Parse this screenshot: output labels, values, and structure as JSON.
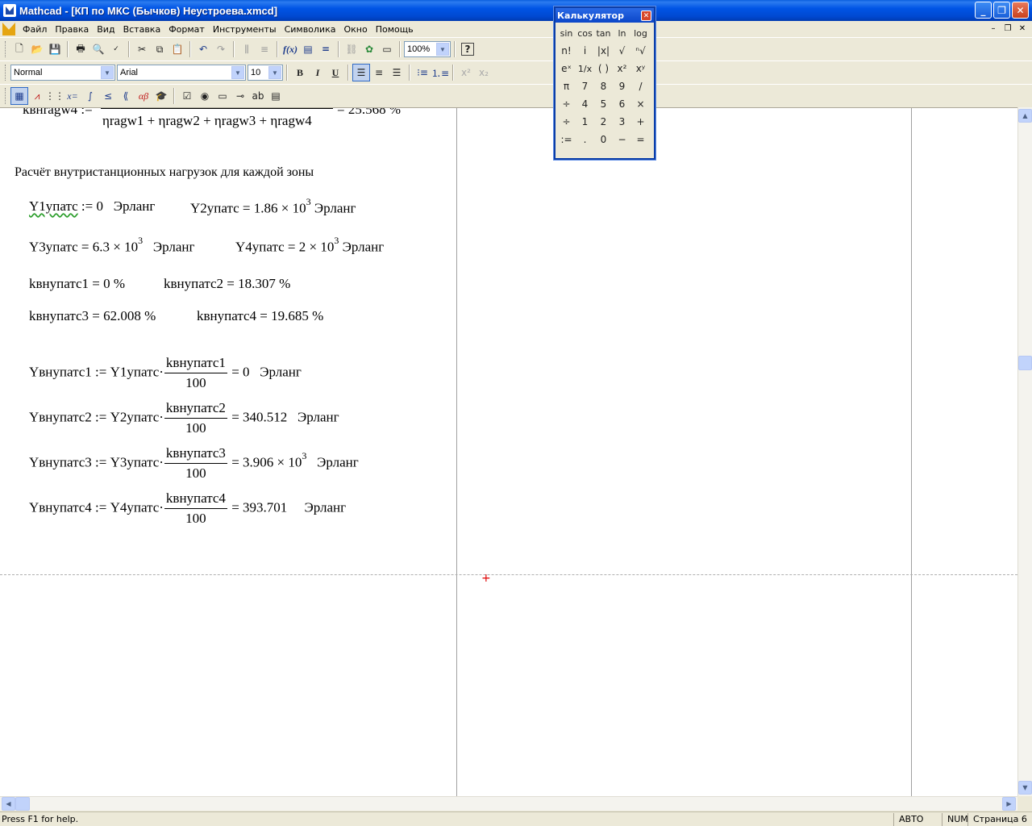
{
  "window": {
    "title": "Mathcad - [КП по МКС (Бычков) Неустроева.xmcd]",
    "buttons": [
      "_",
      "❐",
      "✕"
    ]
  },
  "menu": {
    "items": [
      "Файл",
      "Правка",
      "Вид",
      "Вставка",
      "Формат",
      "Инструменты",
      "Символика",
      "Окно",
      "Помощь"
    ],
    "mdi_buttons": [
      "–",
      "❐",
      "✕"
    ]
  },
  "toolbar_standard": {
    "zoom": "100%"
  },
  "toolbar_formatting": {
    "style": "Normal",
    "font": "Arial",
    "size": "10",
    "bold": "B",
    "italic": "I",
    "underline": "U"
  },
  "document": {
    "top_partial": {
      "lhs": "kвнragw4 :=",
      "rhs": "= 25.568 %",
      "den": "ηragw1 + ηragw2 + ηragw3 + ηragw4"
    },
    "heading": "Расчёт внутристанционных нагрузок для каждой зоны",
    "y1": {
      "name": "Y1упатс",
      "op": ":= 0",
      "unit": "Эрланг"
    },
    "y2": {
      "name": "Y2упатс = 1.86 × 10",
      "exp": "3",
      "unit": "Эрланг"
    },
    "y3": {
      "name": "Y3упатс = 6.3 × 10",
      "exp": "3",
      "unit": "Эрланг"
    },
    "y4": {
      "name": "Y4упатс = 2 × 10",
      "exp": "3",
      "unit": "Эрланг"
    },
    "k1": "kвнупатс1 = 0  %",
    "k2": "kвнупатс2 = 18.307  %",
    "k3": "kвнупатс3 = 62.008  %",
    "k4": "kвнупатс4 = 19.685  %",
    "formulas": [
      {
        "lhs": "Yвнупатс1 := Y1упатс·",
        "num": "kвнупатс1",
        "den": "100",
        "rhs": "= 0",
        "exp": "",
        "unit": "Эрланг"
      },
      {
        "lhs": "Yвнупатс2 := Y2упатс·",
        "num": "kвнупатс2",
        "den": "100",
        "rhs": "= 340.512",
        "exp": "",
        "unit": "Эрланг"
      },
      {
        "lhs": "Yвнупатс3 := Y3упатс·",
        "num": "kвнупатс3",
        "den": "100",
        "rhs": "= 3.906 × 10",
        "exp": "3",
        "unit": "Эрланг"
      },
      {
        "lhs": "Yвнупатс4 := Y4упатс·",
        "num": "kвнупатс4",
        "den": "100",
        "rhs": "= 393.701",
        "exp": "",
        "unit": "Эрланг"
      }
    ]
  },
  "calculator": {
    "title": "Калькулятор",
    "keys": [
      "sin",
      "cos",
      "tan",
      "ln",
      "log",
      "n!",
      "i",
      "|x|",
      "√",
      "ⁿ√",
      "eˣ",
      "1/x",
      "( )",
      "x²",
      "xʸ",
      "π",
      "7",
      "8",
      "9",
      "/",
      "÷",
      "4",
      "5",
      "6",
      "×",
      "÷",
      "1",
      "2",
      "3",
      "+",
      ":=",
      ".",
      "0",
      "−",
      "="
    ]
  },
  "status": {
    "help": "Press F1 for help.",
    "mode": "АВТО",
    "num": "NUM",
    "page": "Страница 6"
  }
}
